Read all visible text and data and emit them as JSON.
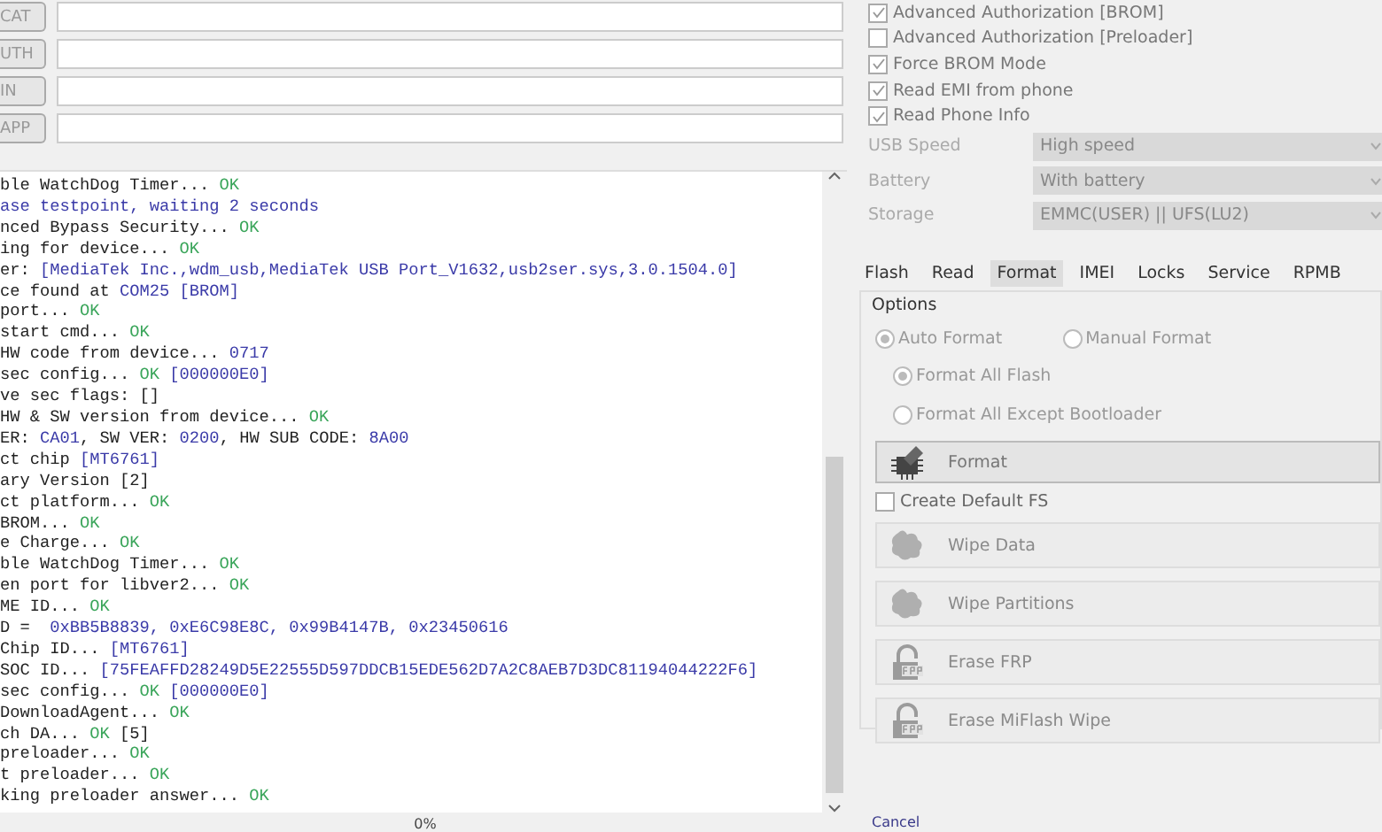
{
  "file_rows": [
    {
      "button": "CAT",
      "value": ""
    },
    {
      "button": "UTH",
      "value": ""
    },
    {
      "button": "IN",
      "value": ""
    },
    {
      "button": "APP",
      "value": ""
    }
  ],
  "log": [
    [
      {
        "t": "ble WatchDog Timer... ",
        "kind": "plain"
      },
      {
        "t": "OK",
        "kind": "ok"
      }
    ],
    [
      {
        "t": "ase testpoint, waiting 2 seconds",
        "kind": "info"
      }
    ],
    [
      {
        "t": "nced Bypass Security... ",
        "kind": "plain"
      },
      {
        "t": "OK",
        "kind": "ok"
      }
    ],
    [
      {
        "t": "ing for device... ",
        "kind": "plain"
      },
      {
        "t": "OK",
        "kind": "ok"
      }
    ],
    [
      {
        "t": "er: ",
        "kind": "plain"
      },
      {
        "t": "[MediaTek Inc.,wdm_usb,MediaTek USB Port_V1632,usb2ser.sys,3.0.1504.0]",
        "kind": "info"
      }
    ],
    [
      {
        "t": "ce found at ",
        "kind": "plain"
      },
      {
        "t": "COM25 [BROM]",
        "kind": "info"
      }
    ],
    [
      {
        "t": "port... ",
        "kind": "plain"
      },
      {
        "t": "OK",
        "kind": "ok"
      }
    ],
    [
      {
        "t": "start cmd... ",
        "kind": "plain"
      },
      {
        "t": "OK",
        "kind": "ok"
      }
    ],
    [
      {
        "t": "HW code from device... ",
        "kind": "plain"
      },
      {
        "t": "0717",
        "kind": "info"
      }
    ],
    [
      {
        "t": "sec config... ",
        "kind": "plain"
      },
      {
        "t": "OK",
        "kind": "ok"
      },
      {
        "t": " [000000E0]",
        "kind": "info"
      }
    ],
    [
      {
        "t": "ve sec flags: []",
        "kind": "plain"
      }
    ],
    [
      {
        "t": "HW & SW version from device... ",
        "kind": "plain"
      },
      {
        "t": "OK",
        "kind": "ok"
      }
    ],
    [
      {
        "t": "ER: ",
        "kind": "plain"
      },
      {
        "t": "CA01",
        "kind": "info"
      },
      {
        "t": ", SW VER: ",
        "kind": "plain"
      },
      {
        "t": "0200",
        "kind": "info"
      },
      {
        "t": ", HW SUB CODE: ",
        "kind": "plain"
      },
      {
        "t": "8A00",
        "kind": "info"
      }
    ],
    [
      {
        "t": "ct chip ",
        "kind": "plain"
      },
      {
        "t": "[MT6761]",
        "kind": "info"
      }
    ],
    [
      {
        "t": "ary Version [2]",
        "kind": "plain"
      }
    ],
    [
      {
        "t": "ct platform... ",
        "kind": "plain"
      },
      {
        "t": "OK",
        "kind": "ok"
      }
    ],
    [
      {
        "t": "BROM... ",
        "kind": "plain"
      },
      {
        "t": "OK",
        "kind": "ok"
      }
    ],
    [
      {
        "t": "e Charge... ",
        "kind": "plain"
      },
      {
        "t": "OK",
        "kind": "ok"
      }
    ],
    [
      {
        "t": "ble WatchDog Timer... ",
        "kind": "plain"
      },
      {
        "t": "OK",
        "kind": "ok"
      }
    ],
    [
      {
        "t": "en port for libver2... ",
        "kind": "plain"
      },
      {
        "t": "OK",
        "kind": "ok"
      }
    ],
    [
      {
        "t": "ME ID... ",
        "kind": "plain"
      },
      {
        "t": "OK",
        "kind": "ok"
      }
    ],
    [
      {
        "t": "D =  ",
        "kind": "plain"
      },
      {
        "t": "0xBB5B8839, 0xE6C98E8C, 0x99B4147B, 0x23450616",
        "kind": "info"
      }
    ],
    [
      {
        "t": "Chip ID... ",
        "kind": "plain"
      },
      {
        "t": "[MT6761]",
        "kind": "info"
      }
    ],
    [
      {
        "t": "SOC ID... ",
        "kind": "plain"
      },
      {
        "t": "[75FEAFFD28249D5E22555D597DDCB15EDE562D7A2C8AEB7D3DC81194044222F6]",
        "kind": "info"
      }
    ],
    [
      {
        "t": "sec config... ",
        "kind": "plain"
      },
      {
        "t": "OK",
        "kind": "ok"
      },
      {
        "t": " [000000E0]",
        "kind": "info"
      }
    ],
    [
      {
        "t": "DownloadAgent... ",
        "kind": "plain"
      },
      {
        "t": "OK",
        "kind": "ok"
      }
    ],
    [
      {
        "t": "ch DA... ",
        "kind": "plain"
      },
      {
        "t": "OK",
        "kind": "ok"
      },
      {
        "t": " [5]",
        "kind": "plain"
      }
    ],
    [
      {
        "t": "preloader... ",
        "kind": "plain"
      },
      {
        "t": "OK",
        "kind": "ok"
      }
    ],
    [
      {
        "t": "t preloader... ",
        "kind": "plain"
      },
      {
        "t": "OK",
        "kind": "ok"
      }
    ],
    [
      {
        "t": "king preloader answer... ",
        "kind": "plain"
      },
      {
        "t": "OK",
        "kind": "ok"
      }
    ]
  ],
  "progress_text": "0%",
  "options_checks": [
    {
      "label": "Advanced Authorization [BROM]",
      "checked": true
    },
    {
      "label": "Advanced Authorization [Preloader]",
      "checked": false
    },
    {
      "label": "Force BROM Mode",
      "checked": true
    },
    {
      "label": "Read EMI from phone",
      "checked": true
    },
    {
      "label": "Read Phone Info",
      "checked": true
    }
  ],
  "dropdowns": [
    {
      "label": "USB Speed",
      "value": "High speed"
    },
    {
      "label": "Battery",
      "value": "With battery"
    },
    {
      "label": "Storage",
      "value": "EMMC(USER) || UFS(LU2)"
    }
  ],
  "tabs": [
    {
      "label": "Flash",
      "selected": false
    },
    {
      "label": "Read",
      "selected": false
    },
    {
      "label": "Format",
      "selected": true
    },
    {
      "label": "IMEI",
      "selected": false
    },
    {
      "label": "Locks",
      "selected": false
    },
    {
      "label": "Service",
      "selected": false
    },
    {
      "label": "RPMB",
      "selected": false
    }
  ],
  "options": {
    "title": "Options",
    "mode_radios": [
      {
        "label": "Auto Format",
        "selected": true
      },
      {
        "label": "Manual Format",
        "selected": false
      }
    ],
    "scope_radios": [
      {
        "label": "Format All Flash",
        "selected": true
      },
      {
        "label": "Format All Except Bootloader",
        "selected": false
      }
    ],
    "format_button": {
      "label": "Format",
      "kind": "chip",
      "disabled": false
    },
    "create_default_fs": {
      "label": "Create Default FS",
      "checked": false
    },
    "actions": [
      {
        "label": "Wipe Data",
        "kind": "blob",
        "disabled": true
      },
      {
        "label": "Wipe Partitions",
        "kind": "blob",
        "disabled": true
      },
      {
        "label": "Erase FRP",
        "kind": "lock",
        "disabled": true
      },
      {
        "label": "Erase MiFlash Wipe",
        "kind": "lock",
        "disabled": true
      }
    ]
  },
  "cancel_link": "Cancel"
}
